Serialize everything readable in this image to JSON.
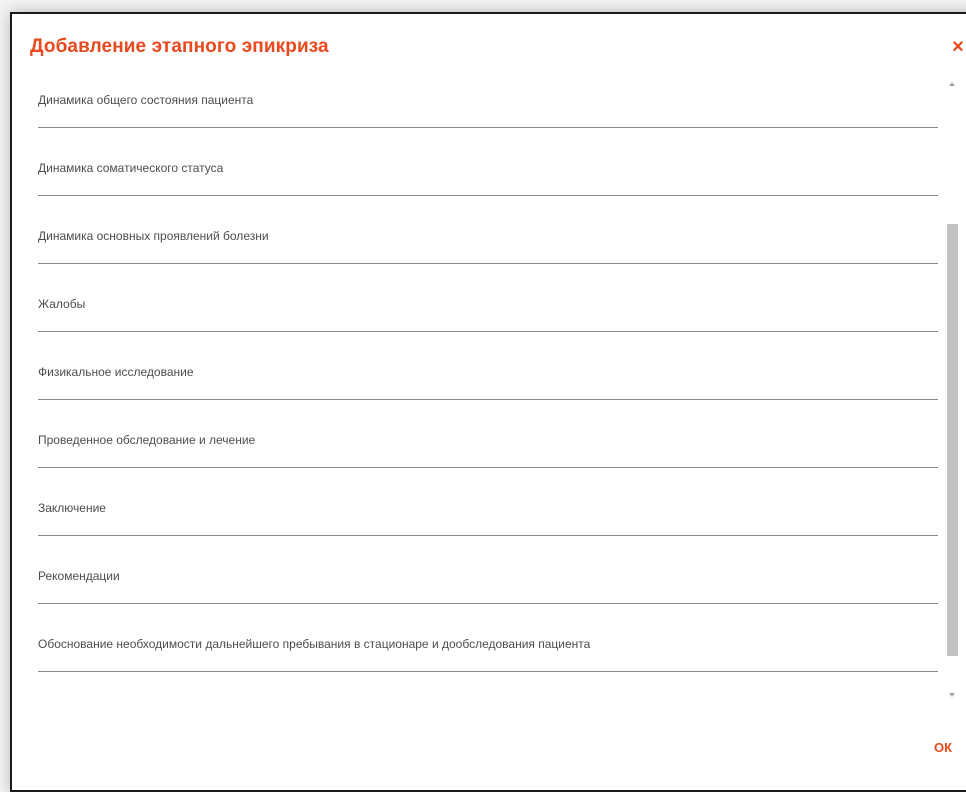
{
  "dialog": {
    "title": "Добавление этапного эпикриза",
    "close_glyph": "×",
    "ok_label": "ОК",
    "accent_color": "#e8491d"
  },
  "fields": [
    {
      "label": "Динамика общего состояния пациента",
      "value": ""
    },
    {
      "label": "Динамика соматического статуса",
      "value": ""
    },
    {
      "label": "Динамика основных проявлений болезни",
      "value": ""
    },
    {
      "label": "Жалобы",
      "value": ""
    },
    {
      "label": "Физикальное исследование",
      "value": ""
    },
    {
      "label": "Проведенное обследование и лечение",
      "value": ""
    },
    {
      "label": "Заключение",
      "value": ""
    },
    {
      "label": "Рекомендации",
      "value": ""
    },
    {
      "label": "Обоснование необходимости дальнейшего пребывания в стационаре и дообследования пациента",
      "value": ""
    }
  ]
}
